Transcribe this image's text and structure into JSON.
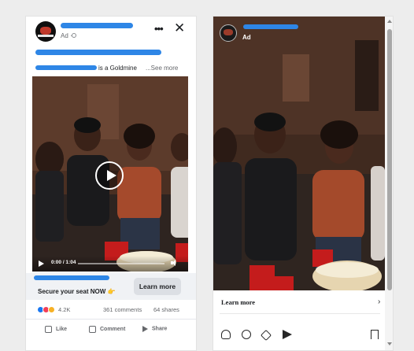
{
  "facebook_post": {
    "sponsored_label": "Ad ·",
    "caption_see_more": "...See more",
    "caption_fragment": "is a Goldmine",
    "video": {
      "time": "0:00 / 1:04",
      "progress": 0.0
    },
    "cta": {
      "text": "Secure your seat NOW 👉",
      "button_label": "Learn more"
    },
    "reactions": {
      "count": "4.2K",
      "comments": "361 comments",
      "shares": "64 shares"
    },
    "actions": {
      "like": "Like",
      "comment": "Comment",
      "share": "Share"
    },
    "header_icons": [
      "more-icon",
      "close-icon"
    ]
  },
  "instagram_post": {
    "sponsored_label": "Ad",
    "learn_more": "Learn more",
    "action_icons": [
      "heart-icon",
      "comment-icon",
      "repost-icon",
      "send-icon",
      "save-icon"
    ]
  },
  "colors": {
    "redaction": "#2e86e6",
    "cta_bar": "#f0f2f5",
    "button": "#dcdfe4"
  }
}
